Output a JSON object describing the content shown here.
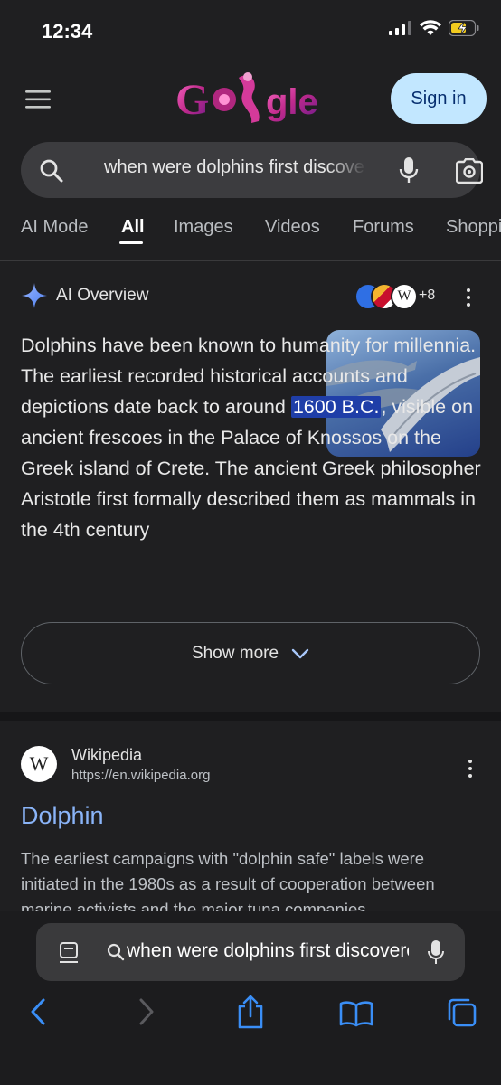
{
  "status_bar": {
    "time": "12:34"
  },
  "header": {
    "logo_text": "Google",
    "sign_in_label": "Sign in"
  },
  "search": {
    "query": "when were dolphins first discovered"
  },
  "tabs": [
    "AI Mode",
    "All",
    "Images",
    "Videos",
    "Forums",
    "Shopping"
  ],
  "ai_overview": {
    "title": "AI Overview",
    "more_sources": "+8",
    "text_before": "Dolphins have been known to humanity for millennia. The earliest recorded historical accounts and depictions date back to around ",
    "highlight": "1600 B.C.",
    "text_after": ", visible on ancient frescoes in the Palace of Knossos on the Greek island of Crete. The ancient Greek philosopher Aristotle first formally described them as mammals in the 4th century",
    "show_more_label": "Show more"
  },
  "result": {
    "site": "Wikipedia",
    "url": "https://en.wikipedia.org",
    "title": "Dolphin",
    "snippet": "The earliest campaigns with \"dolphin safe\" labels were initiated in the 1980s as a result of cooperation between marine activists and the major tuna companies"
  },
  "browser": {
    "address_text": "when were dolphins first discovered"
  },
  "colors": {
    "accent_link": "#8ab4f8",
    "sign_in_bg": "#c2e7ff",
    "highlight_bg": "#1f3ea8",
    "safari_blue": "#3a8ef6"
  }
}
